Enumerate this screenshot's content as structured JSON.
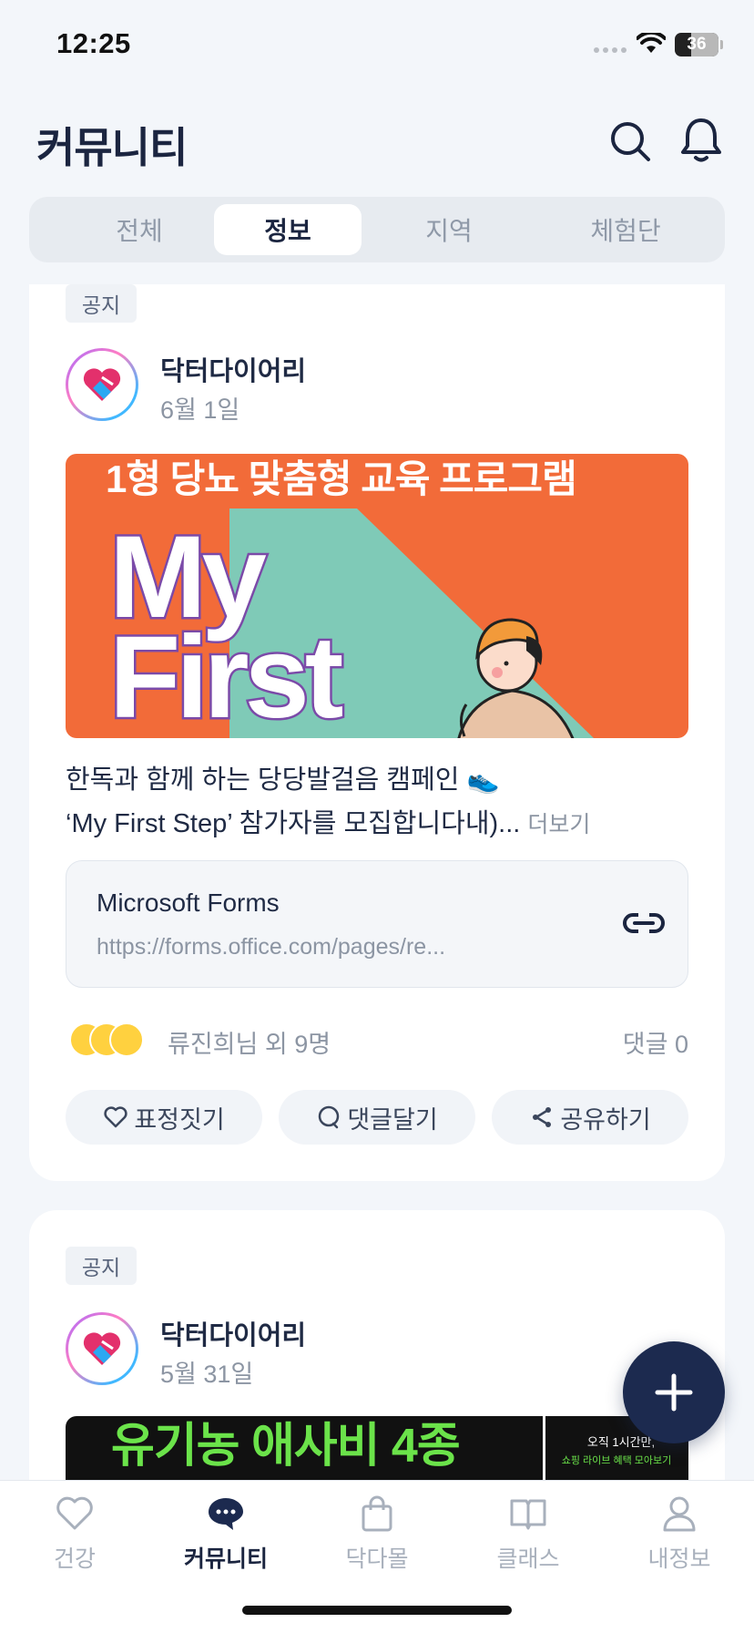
{
  "status_bar": {
    "time": "12:25",
    "battery": "36"
  },
  "header": {
    "title": "커뮤니티"
  },
  "tabs": [
    {
      "label": "전체",
      "active": false
    },
    {
      "label": "정보",
      "active": true
    },
    {
      "label": "지역",
      "active": false
    },
    {
      "label": "체험단",
      "active": false
    }
  ],
  "posts": [
    {
      "badge": "공지",
      "author": "닥터다이어리",
      "date": "6월 1일",
      "banner": {
        "headline": "1형 당뇨 맞춤형 교육 프로그램",
        "big_line1": "My",
        "big_line2": "First"
      },
      "body_line1": "한독과 함께 하는 당당발걸음 캠페인",
      "body_line2": "‘My First Step’ 참가자를 모집합니다내)...",
      "more": "더보기",
      "link": {
        "title": "Microsoft Forms",
        "url": "https://forms.office.com/pages/re..."
      },
      "reaction_text": "류진희님 외 9명",
      "comment_count": "댓글 0",
      "actions": {
        "react": "표정짓기",
        "comment": "댓글달기",
        "share": "공유하기"
      }
    },
    {
      "badge": "공지",
      "author": "닥터다이어리",
      "date": "5월 31일",
      "banner": {
        "headline": "유기농 애사비 4종",
        "right_line1": "오직 1시간만,",
        "right_line2": "쇼핑 라이브 혜택 모아보기"
      }
    }
  ],
  "bottom_nav": [
    {
      "label": "건강",
      "icon": "heart-icon",
      "active": false
    },
    {
      "label": "커뮤니티",
      "icon": "chat-bubble-icon",
      "active": true
    },
    {
      "label": "닥다몰",
      "icon": "shopping-bag-icon",
      "active": false
    },
    {
      "label": "클래스",
      "icon": "book-icon",
      "active": false
    },
    {
      "label": "내정보",
      "icon": "user-icon",
      "active": false
    }
  ],
  "colors": {
    "primary": "#1c2a4f",
    "banner_orange": "#f26b39",
    "banner_teal": "#7fcab7",
    "accent_purple": "#7b4aa8"
  }
}
